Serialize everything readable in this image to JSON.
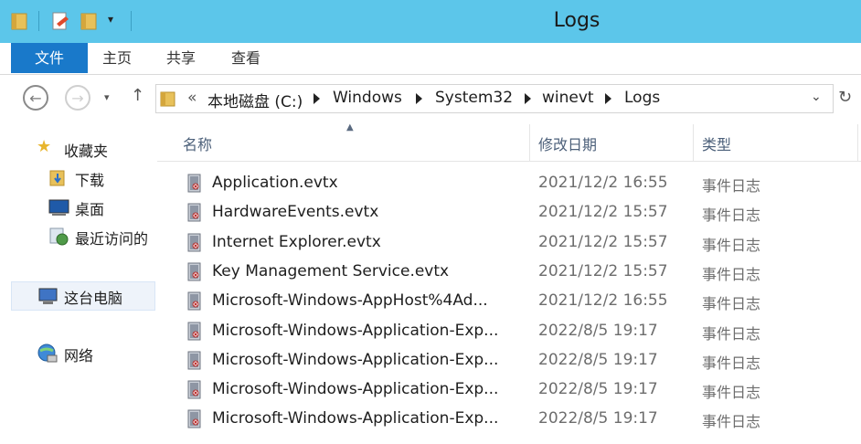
{
  "window": {
    "title": "Logs"
  },
  "ribbon": {
    "tabs": [
      "文件",
      "主页",
      "共享",
      "查看"
    ]
  },
  "address": {
    "overflow": "«",
    "crumbs": [
      "本地磁盘 (C:)",
      "Windows",
      "System32",
      "winevt",
      "Logs"
    ]
  },
  "nav": {
    "items": [
      {
        "label": "收藏夹",
        "icon": "star-icon"
      },
      {
        "label": "下载",
        "icon": "download-folder-icon"
      },
      {
        "label": "桌面",
        "icon": "desktop-icon"
      },
      {
        "label": "最近访问的",
        "icon": "recent-places-icon"
      },
      {
        "label": "这台电脑",
        "icon": "computer-icon"
      },
      {
        "label": "网络",
        "icon": "network-icon"
      }
    ]
  },
  "columns": {
    "name": "名称",
    "date": "修改日期",
    "type": "类型"
  },
  "files": [
    {
      "name": "Application.evtx",
      "date": "2021/12/2 16:55",
      "type": "事件日志"
    },
    {
      "name": "HardwareEvents.evtx",
      "date": "2021/12/2 15:57",
      "type": "事件日志"
    },
    {
      "name": "Internet Explorer.evtx",
      "date": "2021/12/2 15:57",
      "type": "事件日志"
    },
    {
      "name": "Key Management Service.evtx",
      "date": "2021/12/2 15:57",
      "type": "事件日志"
    },
    {
      "name": "Microsoft-Windows-AppHost%4Ad...",
      "date": "2021/12/2 16:55",
      "type": "事件日志"
    },
    {
      "name": "Microsoft-Windows-Application-Exp...",
      "date": "2022/8/5 19:17",
      "type": "事件日志"
    },
    {
      "name": "Microsoft-Windows-Application-Exp...",
      "date": "2022/8/5 19:17",
      "type": "事件日志"
    },
    {
      "name": "Microsoft-Windows-Application-Exp...",
      "date": "2022/8/5 19:17",
      "type": "事件日志"
    },
    {
      "name": "Microsoft-Windows-Application-Exp...",
      "date": "2022/8/5 19:17",
      "type": "事件日志"
    }
  ],
  "colors": {
    "titlebar": "#5cc6ea",
    "file_tab": "#1979ca",
    "header_text": "#4c607a"
  }
}
